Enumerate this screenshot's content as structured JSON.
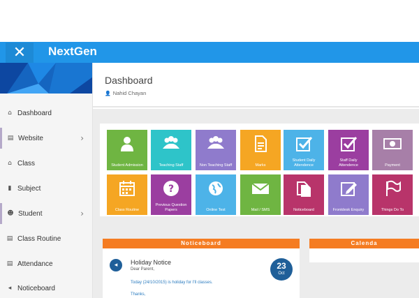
{
  "app": {
    "brand": "NextGen",
    "close_glyph": "✕"
  },
  "colors": {
    "topbar": "#2196e8",
    "notice_header": "#f57c22",
    "badge": "#1f5f99"
  },
  "sidebar": {
    "items": [
      {
        "label": "Dashboard",
        "icon": "home-icon",
        "glyph": "⌂",
        "chevron": ""
      },
      {
        "label": "Website",
        "icon": "website-icon",
        "glyph": "▤",
        "chevron": "›"
      },
      {
        "label": "Class",
        "icon": "class-icon",
        "glyph": "⌂",
        "chevron": ""
      },
      {
        "label": "Subject",
        "icon": "book-icon",
        "glyph": "▮",
        "chevron": ""
      },
      {
        "label": "Student",
        "icon": "users-icon",
        "glyph": "☻",
        "chevron": "›"
      },
      {
        "label": "Class Routine",
        "icon": "routine-icon",
        "glyph": "▤",
        "chevron": ""
      },
      {
        "label": "Attendance",
        "icon": "attendance-icon",
        "glyph": "▤",
        "chevron": ""
      },
      {
        "label": "Noticeboard",
        "icon": "megaphone-icon",
        "glyph": "◂",
        "chevron": ""
      }
    ]
  },
  "header": {
    "title": "Dashboard",
    "user": "Nahid Chayan",
    "user_glyph": "👤"
  },
  "tiles": [
    {
      "label": "Student Admission",
      "icon": "student-icon",
      "color": "#6fb542"
    },
    {
      "label": "Teaching Staff",
      "icon": "staff-icon",
      "color": "#2ec4c9"
    },
    {
      "label": "Non Teaching Staff",
      "icon": "staff-group-icon",
      "color": "#8f7bcc"
    },
    {
      "label": "Marks",
      "icon": "document-icon",
      "color": "#f5a623"
    },
    {
      "label": "Student Daily Attendence",
      "icon": "checkbox-icon",
      "color": "#4db3e8"
    },
    {
      "label": "Staff Daily Attendence",
      "icon": "checkbox-icon",
      "color": "#9b3ea0"
    },
    {
      "label": "Payment",
      "icon": "money-icon",
      "color": "#a77fa8"
    },
    {
      "label": "Class Routine",
      "icon": "calendar-icon",
      "color": "#f5a623"
    },
    {
      "label": "Previous Question Papers",
      "icon": "question-icon",
      "color": "#9b3ea0"
    },
    {
      "label": "Online Test",
      "icon": "globe-icon",
      "color": "#4db3e8"
    },
    {
      "label": "Mail / SMS",
      "icon": "mail-icon",
      "color": "#6fb542"
    },
    {
      "label": "Noticeboard",
      "icon": "files-icon",
      "color": "#b8346a"
    },
    {
      "label": "Frontdesk Enquiry",
      "icon": "edit-icon",
      "color": "#8f7bcc"
    },
    {
      "label": "Things Do To",
      "icon": "flag-icon",
      "color": "#b8346a"
    }
  ],
  "noticeboard": {
    "title": "Noticeboard",
    "icon_glyph": "◂",
    "heading": "Holiday Notice",
    "greeting": "Dear Parent,",
    "body": "Today (24/10/2015) is holiday for I'll classes.",
    "thanks": "Thanks,",
    "day": "23",
    "month": "Oct"
  },
  "calendar": {
    "title": "Calenda"
  }
}
